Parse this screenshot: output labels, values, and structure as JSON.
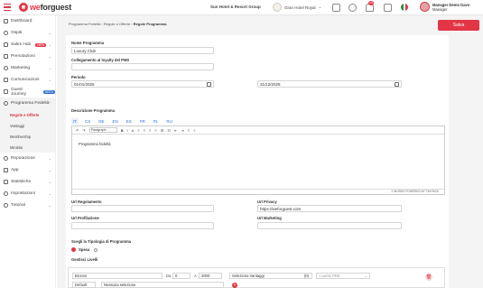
{
  "topbar": {
    "logo_part1": "we",
    "logo_part2": "forguest",
    "group_name": "Sun Hotel & Resort Group",
    "hotel_name": "Gran Hotel Royal",
    "notif_count": "10",
    "user_name": "Manager Demo Davo",
    "user_role": "Manager"
  },
  "sidebar": {
    "items": [
      {
        "label": "Dashboard",
        "chev": ""
      },
      {
        "label": "Ospiti",
        "chev": "⌄"
      },
      {
        "label": "Sales Hub",
        "badge": "NEW",
        "chev": "⌄"
      },
      {
        "label": "Prenotazioni",
        "chev": "⌄"
      },
      {
        "label": "Marketing",
        "chev": "⌄"
      },
      {
        "label": "Comunicazioni",
        "chev": "⌄"
      },
      {
        "label": "Guest Journey",
        "badge": "BETA",
        "chev": ""
      },
      {
        "label": "Programma Fedeltà",
        "chev": "⌃"
      }
    ],
    "sub_items": [
      "Regole e Offerte",
      "Vantaggi",
      "Membership",
      "Ministio"
    ],
    "items_after": [
      {
        "label": "Reputazione",
        "chev": "⌄"
      },
      {
        "label": "App",
        "chev": "⌄"
      },
      {
        "label": "Statistiche",
        "chev": "⌄"
      },
      {
        "label": "Impostazioni",
        "chev": "⌄"
      },
      {
        "label": "Tutorial",
        "chev": "⌄"
      }
    ],
    "colors": {
      "new": "#e23645",
      "beta": "#2b6fcf"
    }
  },
  "main": {
    "breadcrumb": [
      "Programma Fedeltà",
      "Regole e Offerte",
      "Regole Programma"
    ],
    "save_label": "Salva",
    "name_label": "Nome Programma",
    "name_value": "Luxury Club",
    "pms_label": "Collegamento al loyalty del PMS",
    "pms_value": "",
    "period_label": "Periodo",
    "date_start": "01/01/2025",
    "date_end": "31/12/2025",
    "desc_label": "Descrizione Programma",
    "langs": [
      "IT",
      "CS",
      "DE",
      "EN",
      "ES",
      "FR",
      "PL",
      "RU"
    ],
    "editor_paragraph": "Paragraph",
    "editor_content": "Programma fedeltà",
    "editor_footer": "2 WORDS POWERED BY TINYMCE",
    "url_reg_label": "Url Regolamento",
    "url_reg_value": "",
    "url_privacy_label": "Url Privacy",
    "url_privacy_value": "https://weforguest.com",
    "url_prof_label": "Url Profilazione",
    "url_prof_value": "",
    "url_mkt_label": "Url Marketing",
    "url_mkt_value": "",
    "typology_label": "Scegli la Tipologia di Programma",
    "typology_option": "Spesa",
    "levels_label": "Gestisci Livelli",
    "level": {
      "name": "Bronze",
      "from_label": "Da",
      "from_value": "0",
      "to_label": "A",
      "to_value": "2000",
      "vantaggi_placeholder": "Seleziona Vantaggi",
      "vantaggi_count": "(0)",
      "points_placeholder": "1 punto PRE",
      "default_label": "Default",
      "no_selection": "Nessuna selezione"
    }
  }
}
